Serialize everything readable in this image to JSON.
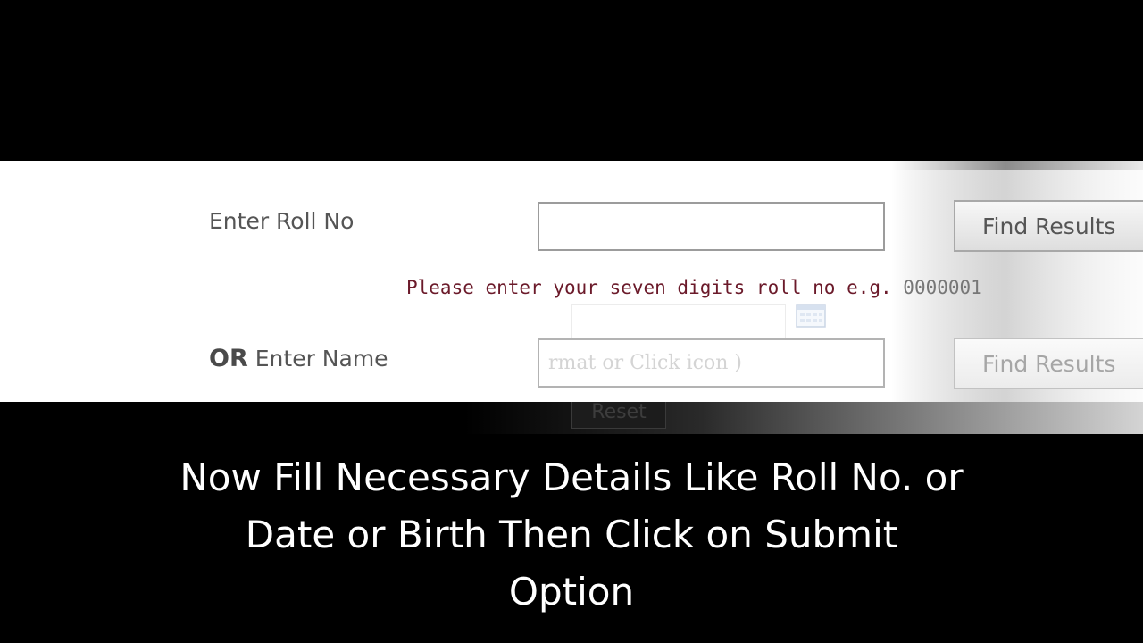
{
  "form": {
    "roll_label": "Enter Roll No",
    "roll_value": "",
    "find_button_label": "Find Results",
    "hint": {
      "prefix": "Please enter your seven digits roll no e.g. ",
      "example": "0000001"
    },
    "name_label_or": "OR",
    "name_label": "Enter Name",
    "name_placeholder": "rmat or Click icon )",
    "find_button_2_label": "Find Results",
    "reset_label": "Reset"
  },
  "caption": {
    "line1": "Now Fill Necessary Details Like Roll No. or",
    "line2": "Date or Birth Then Click on Submit",
    "line3": "Option"
  },
  "colors": {
    "background": "#000000",
    "hint": "#6b1a2a",
    "caption": "#ffffff"
  },
  "icons": {
    "calendar": "calendar-icon"
  }
}
